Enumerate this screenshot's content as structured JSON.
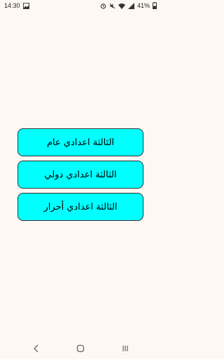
{
  "status_bar": {
    "time": "14:30",
    "battery": "41%"
  },
  "menu": {
    "buttons": [
      {
        "label": "الثالثة اعدادي عام"
      },
      {
        "label": "الثالثة اعدادي دولي"
      },
      {
        "label": "الثالثة اعدادي أحرار"
      }
    ]
  },
  "icons": {
    "status_left": [
      "gallery-icon"
    ],
    "status_right": [
      "alarm-icon",
      "mute-icon",
      "wifi-icon",
      "signal-icon",
      "battery-icon"
    ],
    "nav": [
      "back-icon",
      "home-icon",
      "recents-icon"
    ]
  },
  "colors": {
    "background": "#fdf8f3",
    "button_fill": "#00ffff",
    "button_border": "#333333"
  }
}
